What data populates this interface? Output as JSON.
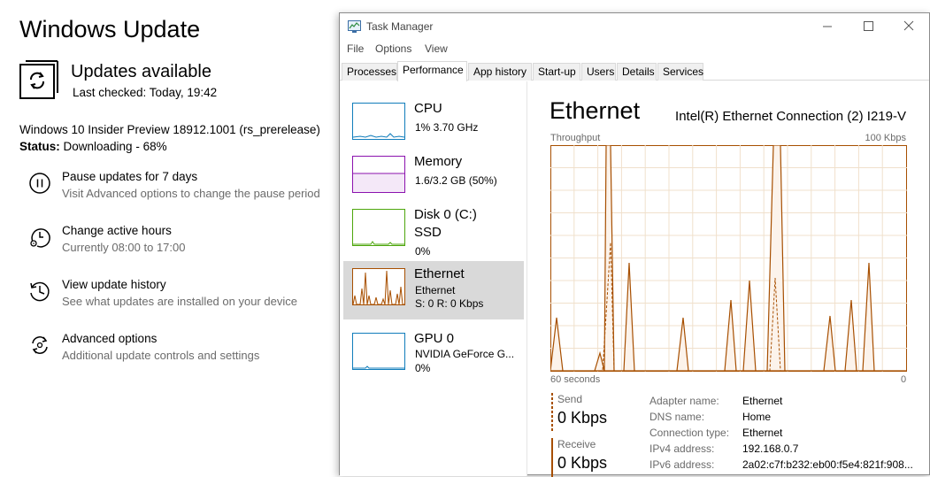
{
  "windows_update": {
    "title": "Windows Update",
    "status_title": "Updates available",
    "last_checked": "Last checked: Today, 19:42",
    "build": "Windows 10 Insider Preview 18912.1001 (rs_prerelease)",
    "status_label": "Status:",
    "status_value": " Downloading - 68%",
    "options": [
      {
        "icon": "pause-icon",
        "title": "Pause updates for 7 days",
        "desc": "Visit Advanced options to change the pause period"
      },
      {
        "icon": "active-hours-icon",
        "title": "Change active hours",
        "desc": "Currently 08:00 to 17:00"
      },
      {
        "icon": "history-icon",
        "title": "View update history",
        "desc": "See what updates are installed on your device"
      },
      {
        "icon": "advanced-options-icon",
        "title": "Advanced options",
        "desc": "Additional update controls and settings"
      }
    ]
  },
  "task_manager": {
    "window_title": "Task Manager",
    "menu": [
      "File",
      "Options",
      "View"
    ],
    "tabs": [
      "Processes",
      "Performance",
      "App history",
      "Start-up",
      "Users",
      "Details",
      "Services"
    ],
    "active_tab": "Performance",
    "resources": [
      {
        "name": "CPU",
        "line1": "1% 3.70 GHz",
        "line2": "",
        "color": "#117dbb"
      },
      {
        "name": "Memory",
        "line1": "1.6/3.2 GB (50%)",
        "line2": "",
        "color": "#8b12ae"
      },
      {
        "name": "Disk 0 (C:)",
        "line1": "SSD",
        "line2": "0%",
        "color": "#4da60c"
      },
      {
        "name": "Ethernet",
        "line1": "Ethernet",
        "line2": "S: 0 R: 0 Kbps",
        "color": "#a74f01"
      },
      {
        "name": "GPU 0",
        "line1": "NVIDIA GeForce G...",
        "line2": "0%",
        "color": "#117dbb"
      }
    ],
    "detail": {
      "title": "Ethernet",
      "adapter": "Intel(R) Ethernet Connection (2) I219-V",
      "throughput_label": "Throughput",
      "max_label": "100 Kbps",
      "time_label": "60 seconds",
      "zero_label": "0",
      "send_label": "Send",
      "send_value": "0 Kbps",
      "receive_label": "Receive",
      "receive_value": "0 Kbps",
      "properties": [
        {
          "label": "Adapter name:",
          "value": "Ethernet"
        },
        {
          "label": "DNS name:",
          "value": "Home"
        },
        {
          "label": "Connection type:",
          "value": "Ethernet"
        },
        {
          "label": "IPv4 address:",
          "value": "192.168.0.7"
        },
        {
          "label": "IPv6 address:",
          "value": "2a02:c7f:b232:eb00:f5e4:821f:908..."
        }
      ]
    },
    "colors": {
      "ethernet": "#a74f01",
      "ethernet_fill": "#fcf3eb",
      "grid": "#f0e0cc"
    }
  }
}
